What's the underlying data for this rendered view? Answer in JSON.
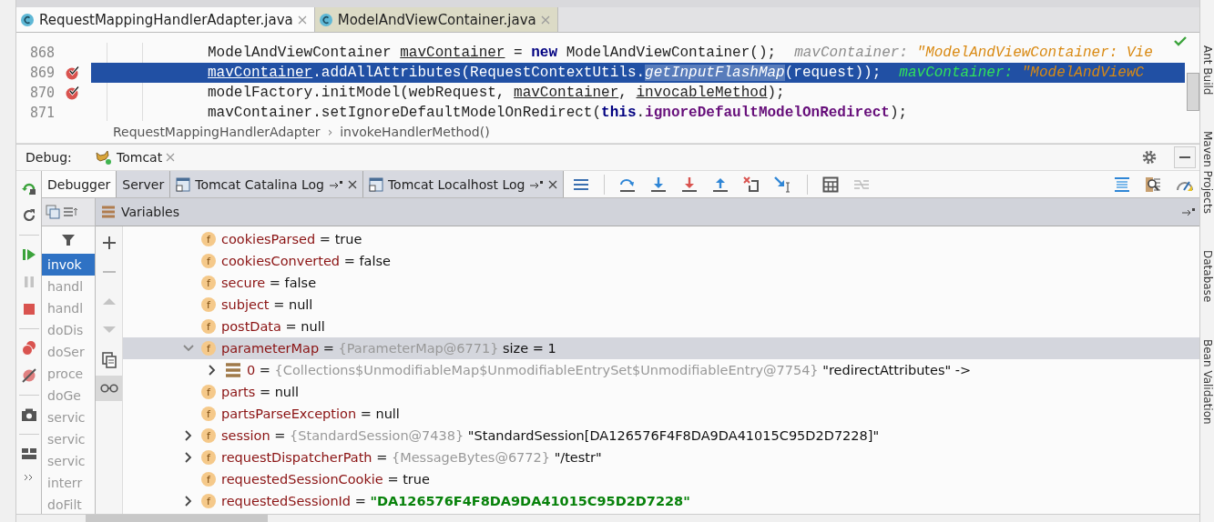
{
  "editor_tabs": [
    {
      "label": "RequestMappingHandlerAdapter.java",
      "selected": true
    },
    {
      "label": "ModelAndViewContainer.java",
      "selected": false
    }
  ],
  "code_lines": [
    {
      "number": "868",
      "breakpoint": false,
      "selected": false,
      "segments": [
        {
          "kind": "text",
          "text": "ModelAndViewContainer "
        },
        {
          "kind": "var",
          "text": "mavContainer"
        },
        {
          "kind": "text",
          "text": " = "
        },
        {
          "kind": "kw",
          "text": "new"
        },
        {
          "kind": "text",
          "text": " ModelAndViewContainer();"
        },
        {
          "kind": "hint-name",
          "text": "mavContainer: "
        },
        {
          "kind": "hint-value",
          "text": "\"ModelAndViewContainer: Vie"
        }
      ]
    },
    {
      "number": "869",
      "breakpoint": true,
      "selected": true,
      "segments": [
        {
          "kind": "var",
          "text": "mavContainer"
        },
        {
          "kind": "text",
          "text": ".addAllAttributes(RequestContextUtils."
        },
        {
          "kind": "italic",
          "text": "getInputFlashMap"
        },
        {
          "kind": "text",
          "text": "(request));"
        },
        {
          "kind": "hint-name",
          "text": "mavContainer: "
        },
        {
          "kind": "hint-value",
          "text": "\"ModelAndViewC"
        }
      ]
    },
    {
      "number": "870",
      "breakpoint": true,
      "selected": false,
      "segments": [
        {
          "kind": "text",
          "text": "modelFactory.initModel(webRequest, "
        },
        {
          "kind": "var",
          "text": "mavContainer"
        },
        {
          "kind": "text",
          "text": ", "
        },
        {
          "kind": "var",
          "text": "invocableMethod"
        },
        {
          "kind": "text",
          "text": ");"
        }
      ]
    },
    {
      "number": "871",
      "breakpoint": false,
      "selected": false,
      "segments": [
        {
          "kind": "text",
          "text": "mavContainer.setIgnoreDefaultModelOnRedirect("
        },
        {
          "kind": "kw",
          "text": "this"
        },
        {
          "kind": "text",
          "text": "."
        },
        {
          "kind": "member",
          "text": "ignoreDefaultModelOnRedirect"
        },
        {
          "kind": "text",
          "text": ");"
        }
      ]
    }
  ],
  "breadcrumb": {
    "items": [
      "RequestMappingHandlerAdapter",
      "invokeHandlerMethod()"
    ],
    "separator": "›"
  },
  "debug": {
    "label": "Debug:",
    "session_tab": "Tomcat"
  },
  "debugger_tabs": [
    {
      "label": "Debugger",
      "selected": true,
      "kind": "plain"
    },
    {
      "label": "Server",
      "selected": false,
      "kind": "plain"
    },
    {
      "label": "Tomcat Catalina Log",
      "selected": false,
      "kind": "log"
    },
    {
      "label": "Tomcat Localhost Log",
      "selected": false,
      "kind": "log"
    }
  ],
  "frames": [
    {
      "label": "invok",
      "selected": true
    },
    {
      "label": "handl",
      "selected": false
    },
    {
      "label": "handl",
      "selected": false
    },
    {
      "label": "doDis",
      "selected": false
    },
    {
      "label": "doSer",
      "selected": false
    },
    {
      "label": "proce",
      "selected": false
    },
    {
      "label": "doGe",
      "selected": false
    },
    {
      "label": "servic",
      "selected": false
    },
    {
      "label": "servic",
      "selected": false
    },
    {
      "label": "servic",
      "selected": false
    },
    {
      "label": "interr",
      "selected": false
    },
    {
      "label": "doFilt",
      "selected": false
    }
  ],
  "variables": {
    "title": "Variables",
    "rows": [
      {
        "expandable": false,
        "kind": "field",
        "badge": "f",
        "name": "cookiesParsed",
        "operator": "=",
        "value": "true",
        "selected": false
      },
      {
        "expandable": false,
        "kind": "field",
        "badge": "f",
        "name": "cookiesConverted",
        "operator": "=",
        "value": "false",
        "selected": false
      },
      {
        "expandable": false,
        "kind": "field",
        "badge": "f",
        "name": "secure",
        "operator": "=",
        "value": "false",
        "selected": false
      },
      {
        "expandable": false,
        "kind": "field",
        "badge": "f",
        "name": "subject",
        "operator": "=",
        "value": "null",
        "selected": false
      },
      {
        "expandable": false,
        "kind": "field",
        "badge": "f",
        "name": "postData",
        "operator": "=",
        "value": "null",
        "selected": false
      },
      {
        "expandable": true,
        "expanded": true,
        "kind": "field",
        "badge": "f",
        "name": "parameterMap",
        "operator": "=",
        "ref": "{ParameterMap@6771}",
        "value": "size = 1",
        "selected": true,
        "children": [
          {
            "expandable": true,
            "expanded": false,
            "kind": "entry",
            "name": "0",
            "operator": "=",
            "ref": "{Collections$UnmodifiableMap$UnmodifiableEntrySet$UnmodifiableEntry@7754}",
            "value": "\"redirectAttributes\" ->",
            "selected": false
          }
        ]
      },
      {
        "expandable": false,
        "kind": "field",
        "badge": "f",
        "name": "parts",
        "operator": "=",
        "value": "null",
        "selected": false
      },
      {
        "expandable": false,
        "kind": "field",
        "badge": "f",
        "name": "partsParseException",
        "operator": "=",
        "value": "null",
        "selected": false
      },
      {
        "expandable": true,
        "expanded": false,
        "kind": "field",
        "badge": "f",
        "name": "session",
        "operator": "=",
        "ref": "{StandardSession@7438}",
        "value": "\"StandardSession[DA126576F4F8DA9DA41015C95D2D7228]\"",
        "selected": false
      },
      {
        "expandable": true,
        "expanded": false,
        "kind": "field",
        "badge": "f",
        "name": "requestDispatcherPath",
        "operator": "=",
        "ref": "{MessageBytes@6772}",
        "value": "\"/testr\"",
        "selected": false
      },
      {
        "expandable": false,
        "kind": "field",
        "badge": "f",
        "name": "requestedSessionCookie",
        "operator": "=",
        "value": "true",
        "selected": false
      },
      {
        "expandable": true,
        "expanded": false,
        "kind": "field",
        "badge": "f",
        "name": "requestedSessionId",
        "operator": "=",
        "string": "\"DA126576F4F8DA9DA41015C95D2D7228\"",
        "selected": false
      }
    ]
  },
  "side_strip": [
    "Ant Build",
    "Maven Projects",
    "Database",
    "Bean Validation"
  ]
}
